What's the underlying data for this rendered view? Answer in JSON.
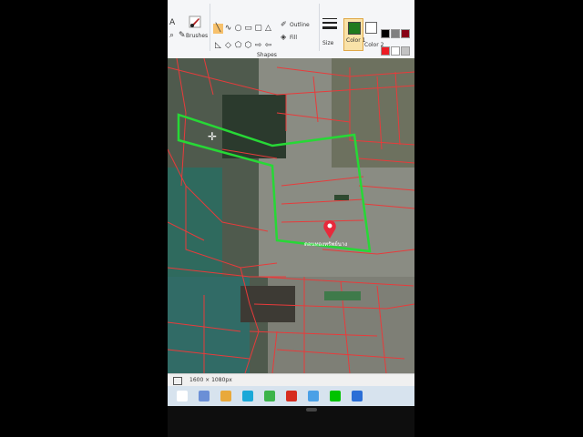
{
  "ribbon": {
    "brushes_label": "Brushes",
    "shapes_label": "Shapes",
    "outline_label": "Outline",
    "fill_label": "Fill",
    "size_label": "Size",
    "color1_label": "Color 1",
    "color2_label": "Color 2",
    "shape_icons": [
      "╲",
      "∿",
      "○",
      "▭",
      "▢",
      "△",
      "◺",
      "◇",
      "⬠",
      "⬡",
      "⇨",
      "⇦",
      "⇧",
      "⇩",
      "✦",
      "★",
      "✡",
      "◯",
      "▭",
      "☁"
    ],
    "palette_colors": [
      "#000000",
      "#7f7f7f",
      "#880015",
      "#ed1c24",
      "#ffffff",
      "#c3c3c3",
      "#b97a57",
      "#ffaec9"
    ],
    "color1_value": "#1f7a1f",
    "color2_value": "#ffffff"
  },
  "canvas": {
    "map_label": "ดอนทองทรัพย์นาง"
  },
  "status": {
    "dimensions": "1600 × 1080px"
  }
}
